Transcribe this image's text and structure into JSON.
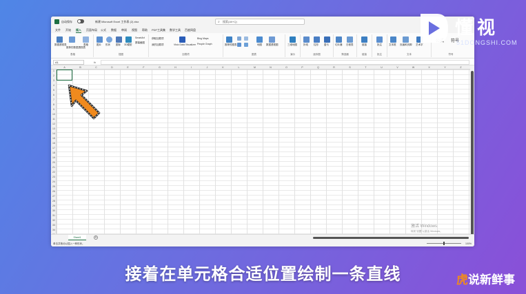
{
  "title_bar": {
    "autosave_label": "自动保存",
    "file_name": "新建 Microsoft Excel 工作表 (2).xlsx",
    "search_placeholder": "搜索(Alt+Q)"
  },
  "tabs": [
    "文件",
    "开始",
    "插入",
    "页面布局",
    "公式",
    "数据",
    "审阅",
    "视图",
    "帮助",
    "PDF工具集",
    "数学工具",
    "百度网盘"
  ],
  "active_tab": "插入",
  "ribbon": {
    "groups": [
      {
        "label": "表格",
        "items": [
          "数据透视表",
          "推荐的数据透视表",
          "表格"
        ]
      },
      {
        "label": "插图",
        "items": [
          "图片",
          "形状",
          "图标",
          "3D模型",
          "SmartArt",
          "屏幕截图"
        ]
      },
      {
        "label": "加载项",
        "items": [
          "获取加载项",
          "我的加载项",
          "Visio Data Visualizer",
          "Bing Maps",
          "People Graph"
        ]
      },
      {
        "label": "图表",
        "items": [
          "推荐的图表",
          "地图",
          "数据透视图"
        ]
      },
      {
        "label": "演示",
        "items": [
          "三维地图"
        ]
      },
      {
        "label": "迷你图",
        "items": [
          "折线",
          "柱形",
          "盈亏"
        ]
      },
      {
        "label": "筛选器",
        "items": [
          "切片器",
          "日程表"
        ]
      },
      {
        "label": "链接",
        "items": [
          "链接"
        ]
      },
      {
        "label": "批注",
        "items": [
          "批注"
        ]
      },
      {
        "label": "文本",
        "items": [
          "文本框",
          "页眉和页脚",
          "艺术字"
        ]
      },
      {
        "label": "符号",
        "items": [
          "公式",
          "符号"
        ]
      }
    ]
  },
  "name_box": "A1",
  "fx_label": "fx",
  "columns": [
    "A",
    "B",
    "C",
    "D",
    "E",
    "F",
    "G",
    "H",
    "I",
    "J",
    "K",
    "L",
    "M",
    "N",
    "O",
    "P",
    "Q",
    "R",
    "S",
    "T",
    "U",
    "V",
    "W",
    "X",
    "Y",
    "Z"
  ],
  "rows": [
    "1",
    "2",
    "3",
    "4",
    "5",
    "6",
    "7",
    "8",
    "9",
    "10",
    "11",
    "12",
    "13",
    "14",
    "15",
    "16",
    "17",
    "18",
    "19",
    "20",
    "21",
    "22",
    "23",
    "24",
    "25",
    "26",
    "27",
    "28",
    "29",
    "30",
    "31",
    "32",
    "33",
    "34",
    "35"
  ],
  "sheet_tab": "Sheet1",
  "add_sheet": "+",
  "status_text": "单击并拖动以插入一种形状。",
  "zoom": "100%",
  "activate_windows": {
    "title": "激活 Windows",
    "hint": "转到\"设置\"以激活 Windows。"
  },
  "logo": {
    "text": "懂视",
    "sub": "51DONGSHI.COM"
  },
  "subtitle": "接着在单元格合适位置绘制一条直线",
  "brand": {
    "hu": "虎",
    "rest": "说新鲜事"
  },
  "colors": {
    "excel_green": "#1d6f42",
    "arrow_orange": "#f08a1e"
  }
}
